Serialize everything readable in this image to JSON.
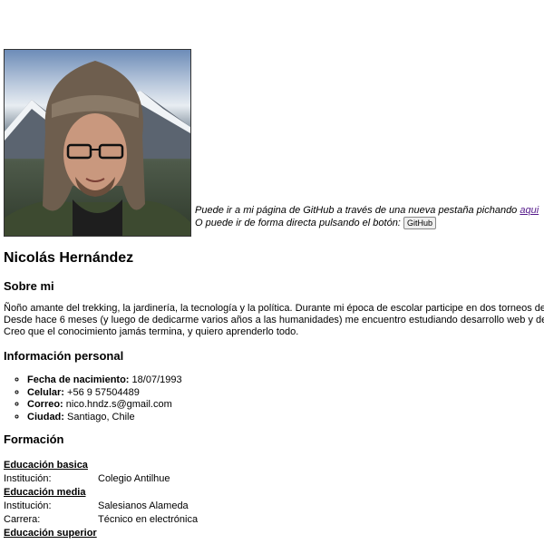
{
  "intro": {
    "github_text": "Puede ir a mi página de GitHub a través de una nueva pestaña pichando",
    "github_link": "aqui",
    "direct_text": "O puede ir de forma directa pulsando el botón:",
    "github_button": "GitHub"
  },
  "name": "Nicolás Hernández",
  "about": {
    "heading": "Sobre mi",
    "lines": [
      "Ñoño amante del trekking, la jardinería, la tecnología y la política. Durante mi época de escolar participe en dos torneos de r",
      "Desde hace 6 meses (y luego de dedicarme varios años a las humanidades) me encuentro estudiando desarrollo web y de",
      "Creo que el conocimiento jamás termina, y quiero aprenderlo todo."
    ]
  },
  "personal": {
    "heading": "Información personal",
    "items": [
      {
        "label": "Fecha de nacimiento:",
        "value": "18/07/1993"
      },
      {
        "label": "Celular:",
        "value": "+56 9 57504489"
      },
      {
        "label": "Correo:",
        "value": "nico.hndz.s@gmail.com"
      },
      {
        "label": "Ciudad:",
        "value": "Santiago, Chile"
      }
    ]
  },
  "education": {
    "heading": "Formación",
    "basic": {
      "title": "Educación basica",
      "inst_label": "Institución:",
      "inst_value": "Colegio Antilhue"
    },
    "middle": {
      "title": "Educación media",
      "inst_label": "Institución:",
      "inst_value": "Salesianos Alameda",
      "career_label": "Carrera:",
      "career_value": "Técnico en electrónica"
    },
    "higher": {
      "title": "Educación superior"
    }
  }
}
